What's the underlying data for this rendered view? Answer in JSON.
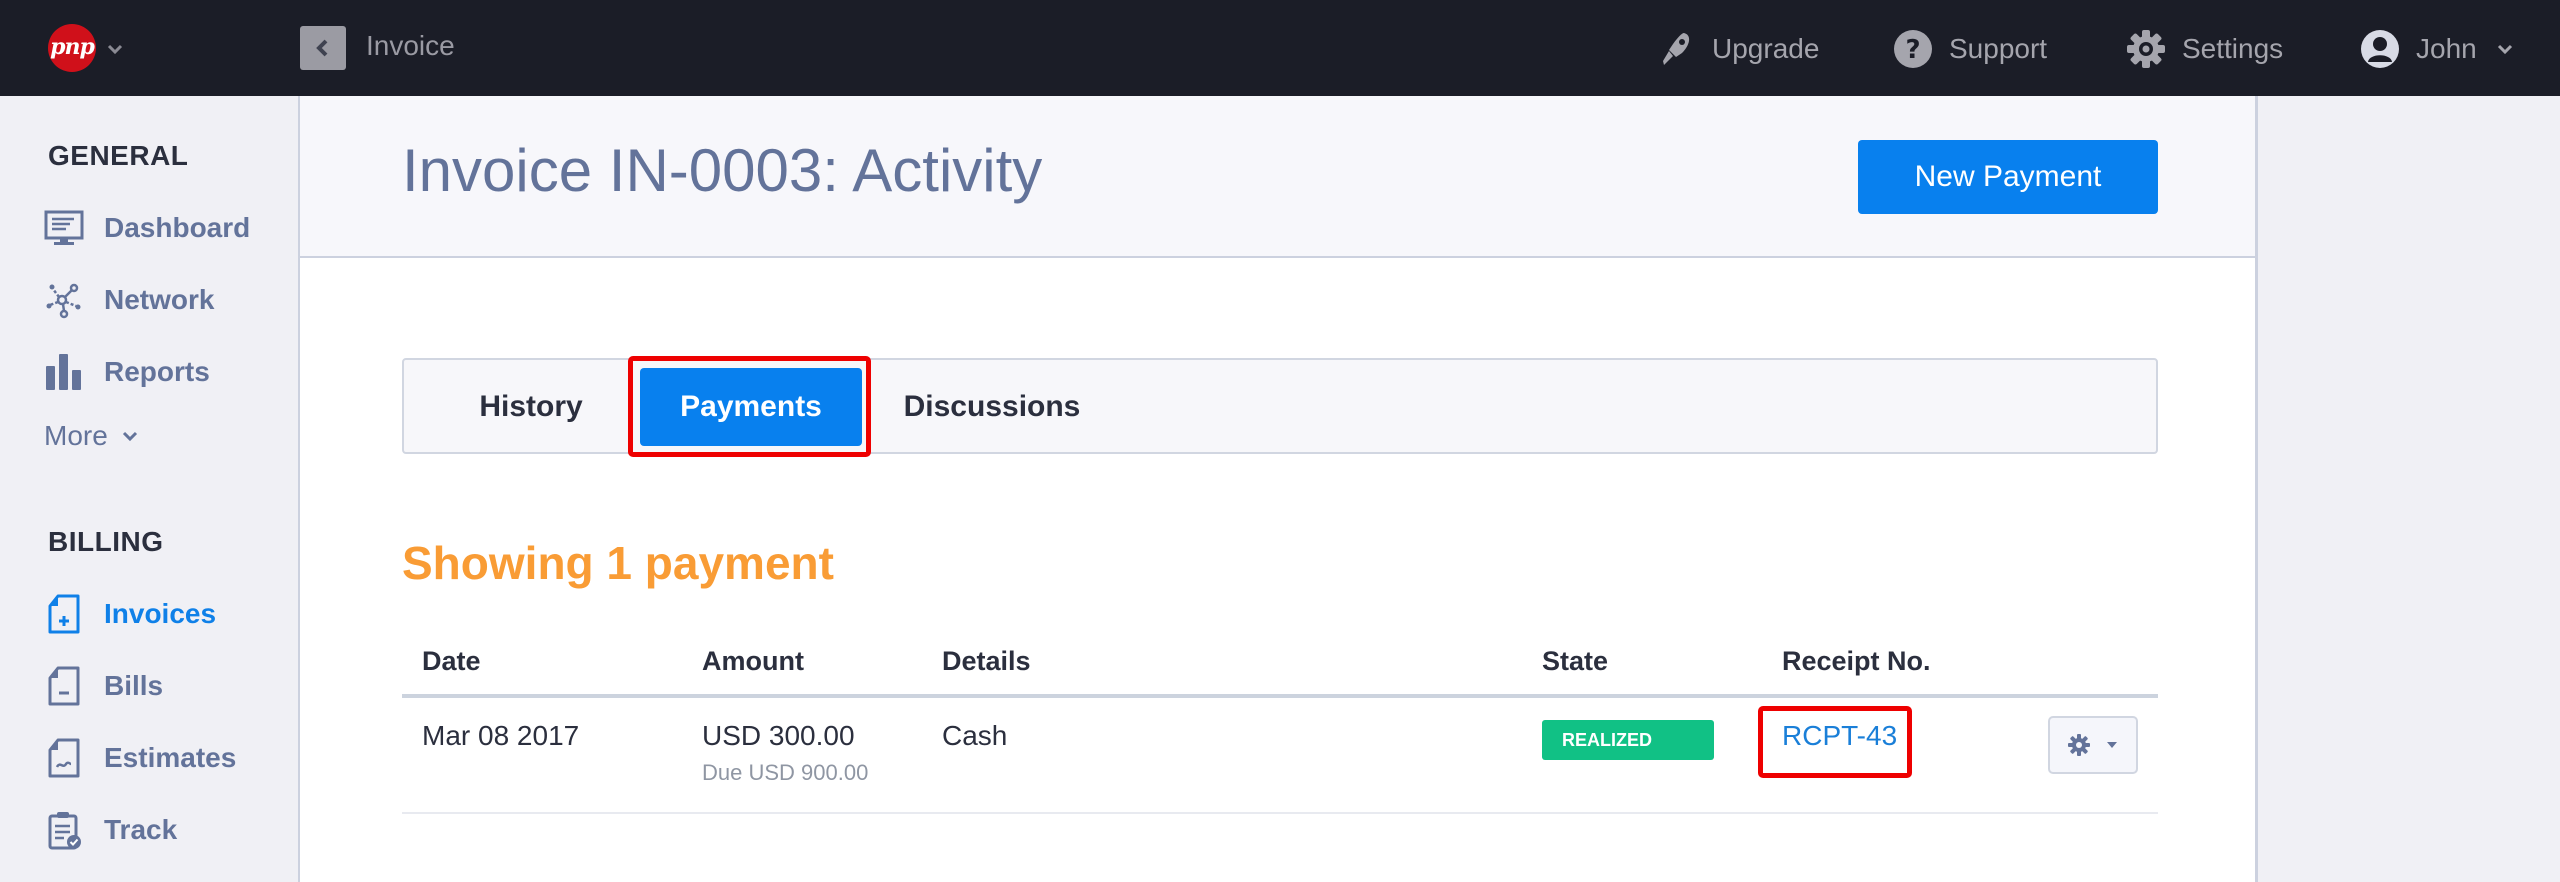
{
  "topbar": {
    "logo_text": "pnp",
    "breadcrumb": "Invoice",
    "nav": [
      {
        "label": "Upgrade",
        "icon": "rocket-icon"
      },
      {
        "label": "Support",
        "icon": "question-circle-icon"
      },
      {
        "label": "Settings",
        "icon": "gear-icon"
      },
      {
        "label": "John",
        "icon": "user-avatar-icon"
      }
    ]
  },
  "sidebar": {
    "sections": [
      {
        "title": "GENERAL",
        "items": [
          {
            "label": "Dashboard",
            "icon": "monitor-icon"
          },
          {
            "label": "Network",
            "icon": "network-icon"
          },
          {
            "label": "Reports",
            "icon": "bar-chart-icon"
          }
        ],
        "more_label": "More"
      },
      {
        "title": "BILLING",
        "items": [
          {
            "label": "Invoices",
            "icon": "invoice-plus-icon",
            "active": true
          },
          {
            "label": "Bills",
            "icon": "bill-minus-icon"
          },
          {
            "label": "Estimates",
            "icon": "estimate-icon"
          },
          {
            "label": "Track",
            "icon": "clipboard-check-icon"
          }
        ]
      }
    ]
  },
  "main": {
    "title": "Invoice IN-0003: Activity",
    "new_payment_label": "New Payment",
    "tabs": [
      {
        "label": "History",
        "active": false
      },
      {
        "label": "Payments",
        "active": true
      },
      {
        "label": "Discussions",
        "active": false
      }
    ],
    "showing_text": "Showing 1 payment",
    "table": {
      "columns": [
        "Date",
        "Amount",
        "Details",
        "State",
        "Receipt No."
      ],
      "rows": [
        {
          "date": "Mar 08 2017",
          "amount": "USD 300.00",
          "due": "Due USD 900.00",
          "details": "Cash",
          "state": "REALIZED",
          "receipt": "RCPT-43"
        }
      ]
    }
  },
  "colors": {
    "topbar_bg": "#1b1d27",
    "accent_blue": "#0880ee",
    "orange": "#f99c35",
    "realized_green": "#11c185",
    "highlight_red": "#ee0000"
  }
}
